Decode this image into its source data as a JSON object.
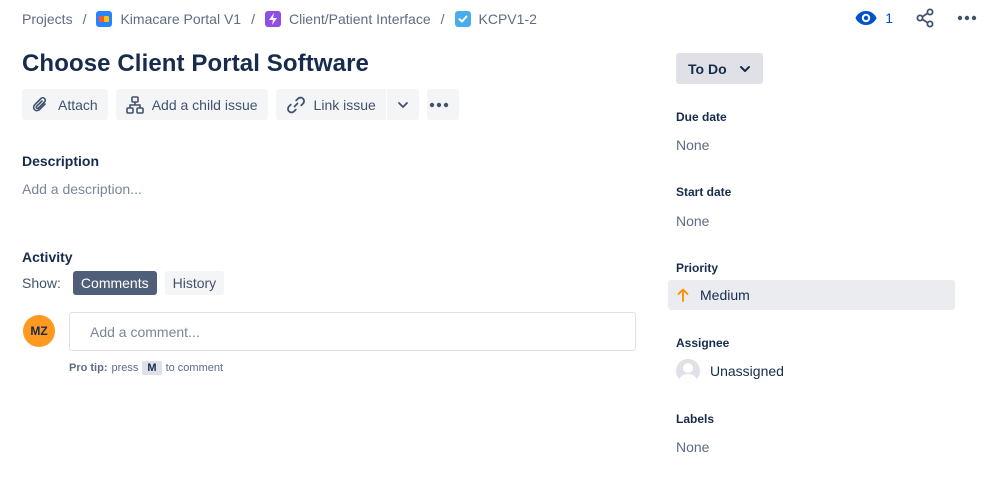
{
  "breadcrumb": {
    "projects": "Projects",
    "project": "Kimacare Portal V1",
    "epic": "Client/Patient Interface",
    "issue_key": "KCPV1-2",
    "separator": "/"
  },
  "top_actions": {
    "watch_count": "1",
    "watch_icon": "eye-icon",
    "share_icon": "share-icon",
    "more_icon": "more-icon"
  },
  "issue": {
    "title": "Choose Client Portal Software"
  },
  "toolbar": {
    "attach": "Attach",
    "add_child": "Add a child issue",
    "link_issue": "Link issue"
  },
  "description": {
    "label": "Description",
    "placeholder": "Add a description..."
  },
  "activity": {
    "label": "Activity",
    "show_label": "Show:",
    "tabs": [
      "Comments",
      "History"
    ],
    "active_tab": "Comments",
    "avatar_initials": "MZ",
    "comment_placeholder": "Add a comment...",
    "protip_bold": "Pro tip:",
    "protip_pre": "press",
    "protip_key": "M",
    "protip_post": "to comment"
  },
  "sidebar": {
    "status": "To Do",
    "due_date": {
      "label": "Due date",
      "value": "None"
    },
    "start_date": {
      "label": "Start date",
      "value": "None"
    },
    "priority": {
      "label": "Priority",
      "value": "Medium"
    },
    "assignee": {
      "label": "Assignee",
      "value": "Unassigned"
    },
    "labels": {
      "label": "Labels",
      "value": "None"
    }
  },
  "colors": {
    "accent": "#0052cc",
    "priority_medium": "#ff8b00",
    "avatar_bg": "#ff991f",
    "active_tab_bg": "#505f79"
  }
}
